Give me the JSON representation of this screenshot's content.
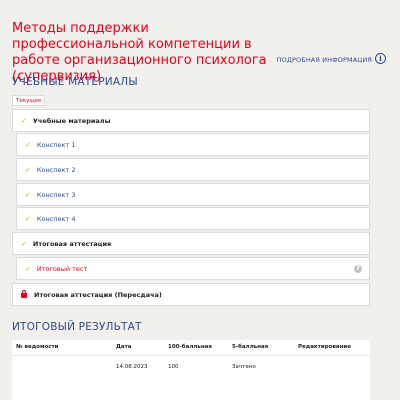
{
  "course": {
    "title": "Методы поддержки профессиональной компетенции в работе организационного психолога (супервизия)"
  },
  "info_link": {
    "label": "ПОДРОБНАЯ ИНФОРМАЦИЯ",
    "icon": "info-icon"
  },
  "materials": {
    "section_title": "УЧЕБНЫЕ МАТЕРИАЛЫ",
    "tab_label": "Текущее",
    "items": [
      {
        "label": "Учебные материалы",
        "level": "parent",
        "status": "checked"
      },
      {
        "label": "Конспект 1",
        "level": "child",
        "status": "checked"
      },
      {
        "label": "Конспект 2",
        "level": "child",
        "status": "checked"
      },
      {
        "label": "Конспект 3",
        "level": "child",
        "status": "checked"
      },
      {
        "label": "Конспект 4",
        "level": "child",
        "status": "checked"
      },
      {
        "label": "Итоговая аттестация",
        "level": "parent",
        "status": "checked"
      },
      {
        "label": "Итоговый тест",
        "level": "child",
        "status": "checked",
        "help_icon": "question-icon"
      },
      {
        "label": "Итоговая аттестация (Пересдача)",
        "level": "parent",
        "status": "locked"
      }
    ]
  },
  "result": {
    "section_title": "ИТОГОВЫЙ РЕЗУЛЬТАТ",
    "columns": [
      "№ ведомости",
      "Дата",
      "100-балльная",
      "5-балльная",
      "Редактирование"
    ],
    "rows": [
      [
        "",
        "14.08.2023",
        "100",
        "Зачтено",
        ""
      ]
    ]
  },
  "colors": {
    "accent_red": "#e2001a",
    "link_blue": "#2f4a8a",
    "check_green": "#8cc63f",
    "background": "#f2f0ed"
  }
}
